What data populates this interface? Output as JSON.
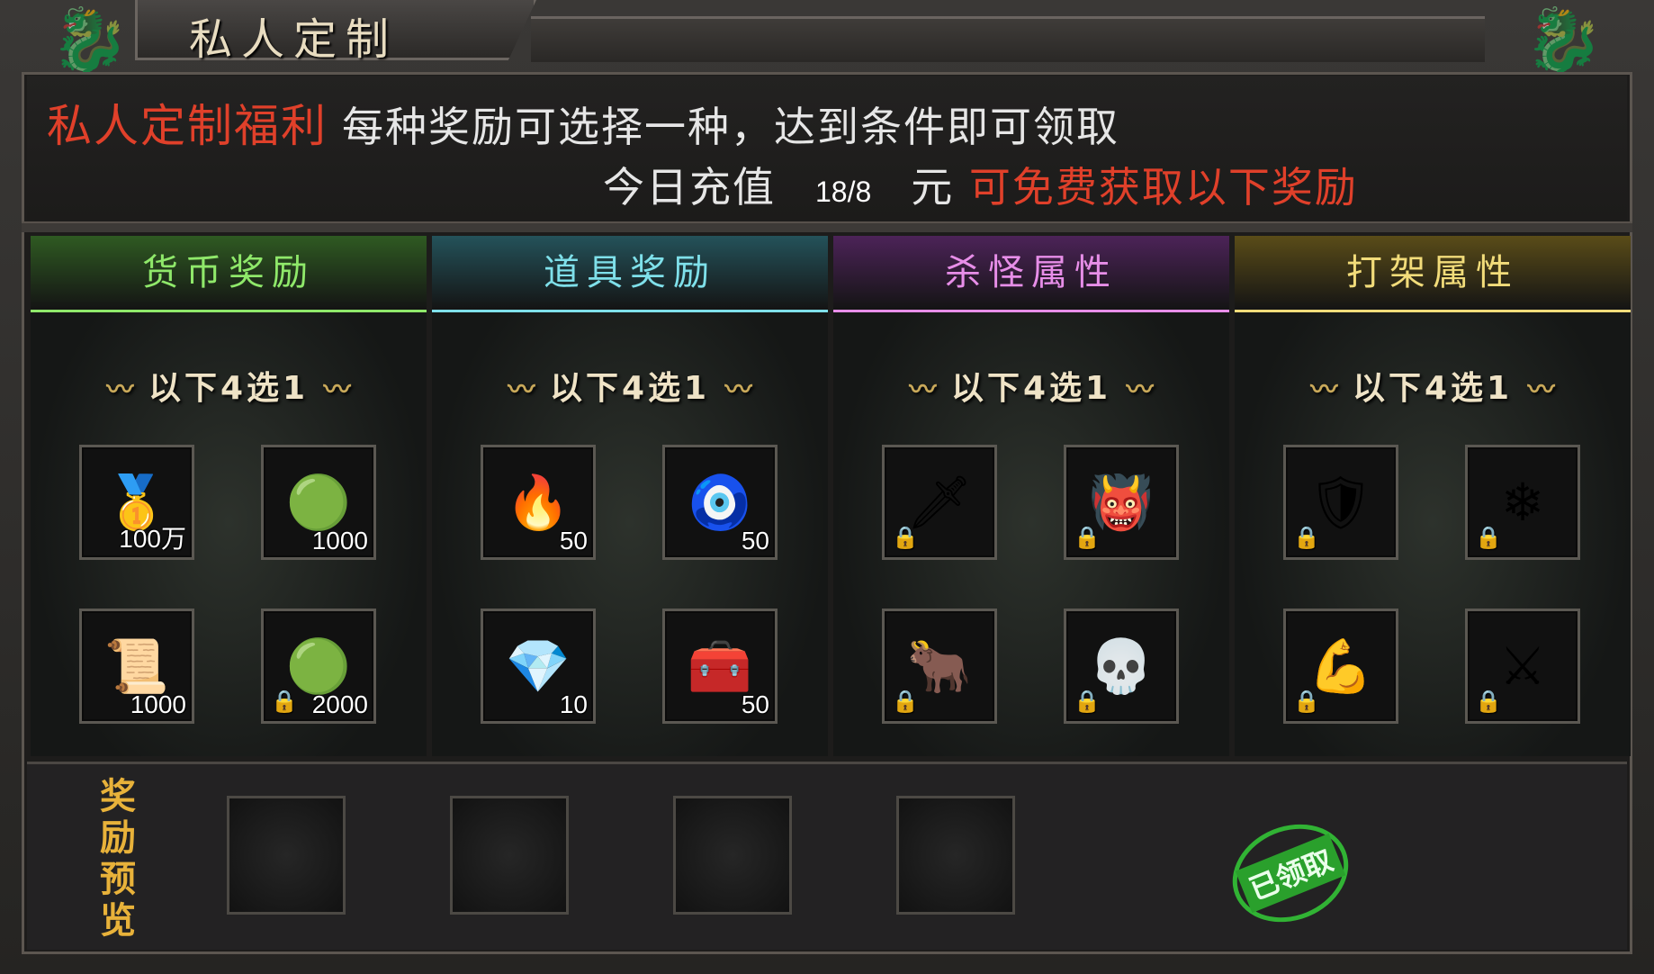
{
  "window": {
    "title": "私人定制"
  },
  "header": {
    "welfare_title": "私人定制福利",
    "description": "每种奖励可选择一种，达到条件即可领取",
    "recharge_label": "今日充值",
    "recharge_value": "18/8",
    "currency_unit": "元",
    "reward_note": "可免费获取以下奖励"
  },
  "columns": [
    {
      "title": "货币奖励",
      "pick_label": "以下4选1",
      "color": "#8fe86a",
      "head_bg": "#2f5a22",
      "items": [
        {
          "icon": "gold-ingot-icon",
          "glyph": "🥇",
          "qty": "100万",
          "locked": false
        },
        {
          "icon": "jade-ring-icon",
          "glyph": "🟢",
          "qty": "1000",
          "locked": false
        },
        {
          "icon": "scroll-icon",
          "glyph": "📜",
          "qty": "1000",
          "locked": false
        },
        {
          "icon": "jade-ring-locked-icon",
          "glyph": "🟢",
          "qty": "2000",
          "locked": true
        }
      ]
    },
    {
      "title": "道具奖励",
      "pick_label": "以下4选1",
      "color": "#7fe0ea",
      "head_bg": "#24525a",
      "items": [
        {
          "icon": "fire-orb-icon",
          "glyph": "🔥",
          "qty": "50",
          "locked": false
        },
        {
          "icon": "talisman-icon",
          "glyph": "🧿",
          "qty": "50",
          "locked": false
        },
        {
          "icon": "crystal-gem-icon",
          "glyph": "💎",
          "qty": "10",
          "locked": false
        },
        {
          "icon": "treasure-chest-icon",
          "glyph": "🧰",
          "qty": "50",
          "locked": false
        }
      ]
    },
    {
      "title": "杀怪属性",
      "pick_label": "以下4选1",
      "color": "#e78ee8",
      "head_bg": "#4c2358",
      "items": [
        {
          "icon": "sword-skill-icon",
          "glyph": "🗡",
          "qty": "",
          "locked": true
        },
        {
          "icon": "demon-crowd-icon",
          "glyph": "👹",
          "qty": "",
          "locked": true
        },
        {
          "icon": "horned-beast-icon",
          "glyph": "🐂",
          "qty": "",
          "locked": true
        },
        {
          "icon": "red-skull-icon",
          "glyph": "💀",
          "qty": "",
          "locked": true
        }
      ]
    },
    {
      "title": "打架属性",
      "pick_label": "以下4选1",
      "color": "#f2dc7a",
      "head_bg": "#5a4c18",
      "items": [
        {
          "icon": "purple-shield-icon",
          "glyph": "🛡",
          "qty": "",
          "locked": true
        },
        {
          "icon": "ice-burst-icon",
          "glyph": "❄",
          "qty": "",
          "locked": true
        },
        {
          "icon": "arm-strike-icon",
          "glyph": "💪",
          "qty": "",
          "locked": true
        },
        {
          "icon": "golden-blade-icon",
          "glyph": "⚔",
          "qty": "",
          "locked": true
        }
      ]
    }
  ],
  "preview": {
    "label": "奖励预览",
    "stamp": "已领取"
  }
}
